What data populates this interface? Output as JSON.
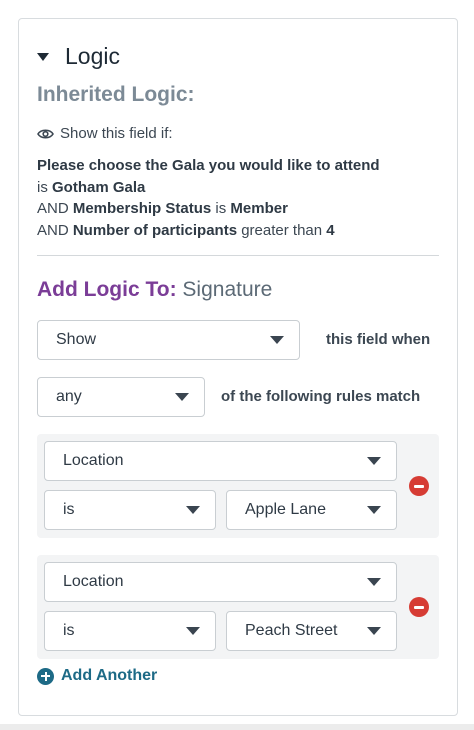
{
  "section": {
    "title": "Logic"
  },
  "inherited": {
    "title": "Inherited Logic:",
    "show_if_label": "Show this field if:",
    "rules": {
      "r1_field": "Please choose the Gala you would like to attend",
      "r1_op": "is",
      "r1_value": "Gotham Gala",
      "r2_conj": "AND",
      "r2_field": "Membership Status",
      "r2_op": "is",
      "r2_value": "Member",
      "r3_conj": "AND",
      "r3_field": "Number of participants",
      "r3_op": "greater than",
      "r3_value": "4"
    }
  },
  "add_logic": {
    "label": "Add Logic To:",
    "target": "Signature",
    "action_value": "Show",
    "action_suffix": "this field when",
    "match_value": "any",
    "match_suffix": "of the following rules match",
    "rules": [
      {
        "field": "Location",
        "operator": "is",
        "value": "Apple Lane"
      },
      {
        "field": "Location",
        "operator": "is",
        "value": "Peach Street"
      }
    ],
    "add_another_label": "Add Another"
  },
  "colors": {
    "accent_purple": "#7b3d97",
    "link_blue": "#1d6a86",
    "remove_red": "#d63c34"
  }
}
